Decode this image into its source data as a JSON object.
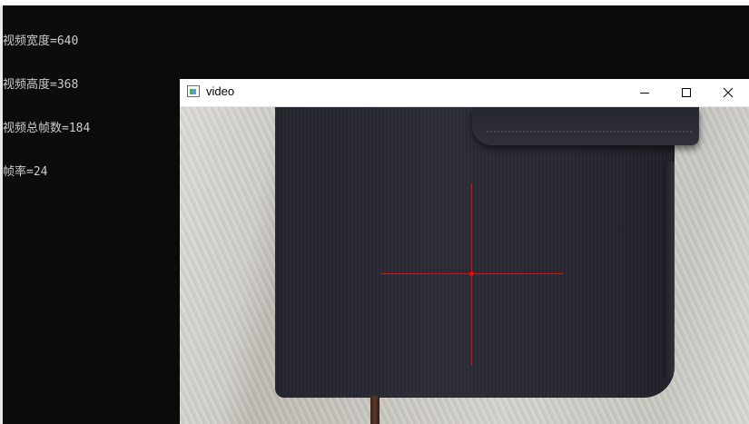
{
  "console": {
    "lines": [
      "视频宽度=640",
      "视频高度=368",
      "视频总帧数=184",
      "帧率=24"
    ]
  },
  "video_window": {
    "title": "video",
    "controls": [
      "minimize-icon",
      "maximize-icon",
      "close-icon"
    ]
  },
  "colors": {
    "console_bg": "#0c0c0c",
    "console_text": "#cccccc",
    "crosshair": "#ff0000"
  }
}
